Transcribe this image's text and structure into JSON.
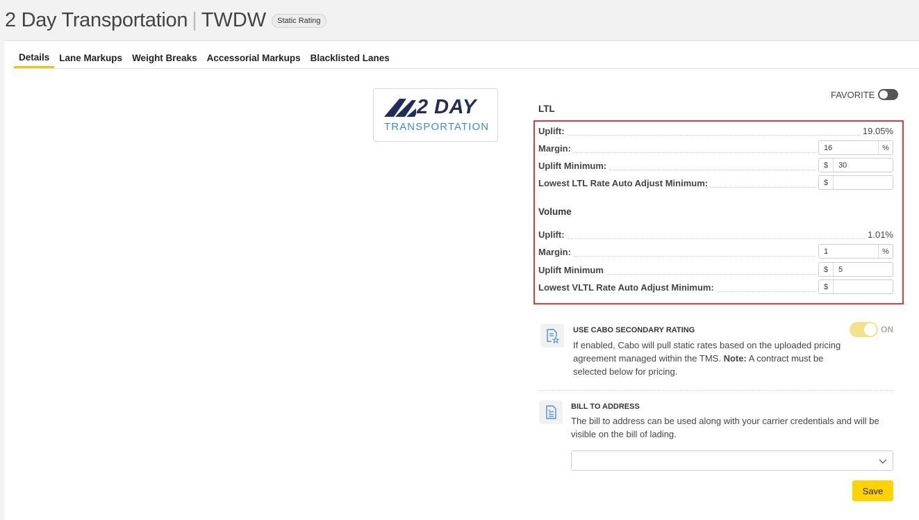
{
  "header": {
    "title": "2 Day Transportation",
    "separator": "|",
    "code": "TWDW",
    "badge": "Static Rating"
  },
  "tabs": [
    {
      "label": "Details",
      "active": true
    },
    {
      "label": "Lane Markups",
      "active": false
    },
    {
      "label": "Weight Breaks",
      "active": false
    },
    {
      "label": "Accessorial Markups",
      "active": false
    },
    {
      "label": "Blacklisted Lanes",
      "active": false
    }
  ],
  "logo": {
    "main": "2 DAY",
    "sub": "TRANSPORTATION",
    "colors": {
      "navy": "#1f2d5c",
      "blue": "#3a8fd0"
    }
  },
  "favorite": {
    "label": "FAVORITE",
    "enabled": false
  },
  "ltl": {
    "title": "LTL",
    "uplift_label": "Uplift:",
    "uplift_value": "19.05%",
    "margin_label": "Margin:",
    "margin_value": "16",
    "margin_suffix": "%",
    "uplift_min_label": "Uplift Minimum:",
    "uplift_min_prefix": "$",
    "uplift_min_value": "30",
    "lowest_label": "Lowest LTL Rate Auto Adjust Minimum:",
    "lowest_prefix": "$",
    "lowest_value": ""
  },
  "volume": {
    "title": "Volume",
    "uplift_label": "Uplift:",
    "uplift_value": "1.01%",
    "margin_label": "Margin:",
    "margin_value": "1",
    "margin_suffix": "%",
    "uplift_min_label": "Uplift Minimum",
    "uplift_min_prefix": "$",
    "uplift_min_value": "5",
    "lowest_label": "Lowest VLTL Rate Auto Adjust Minimum:",
    "lowest_prefix": "$",
    "lowest_value": ""
  },
  "cabo": {
    "icon": "document-star-icon",
    "heading": "USE CABO SECONDARY RATING",
    "text_1": "If enabled, Cabo will pull static rates based on the uploaded pricing",
    "text_2": "agreement managed within the TMS.",
    "note_label": "Note:",
    "text_3": "A contract must be",
    "text_4": "selected below for pricing.",
    "toggle_label": "ON",
    "enabled": true
  },
  "bill_to": {
    "icon": "invoice-icon",
    "heading": "BILL TO ADDRESS",
    "text_1": "The bill to address can be used along with your carrier credentials and will be",
    "text_2": "visible on the bill of lading.",
    "selected": ""
  },
  "save_label": "Save",
  "colors": {
    "accent": "#ffd200",
    "tab_underline": "#f5c400",
    "highlight_box": "#e53935"
  }
}
